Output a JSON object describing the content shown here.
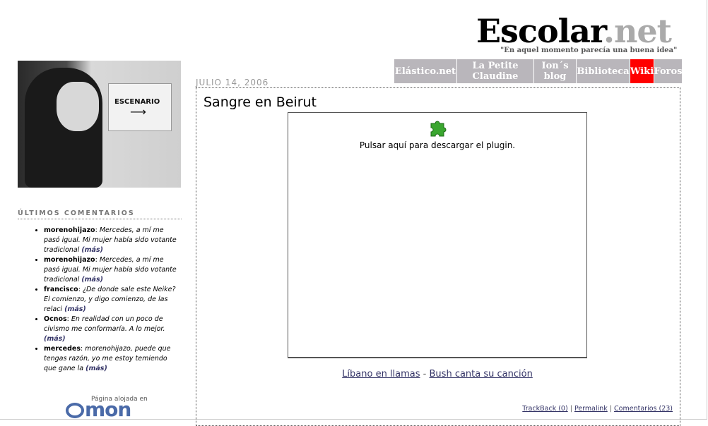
{
  "header": {
    "title_main": "Escolar",
    "title_tld": ".net",
    "tagline": "\"En aquel momento parecía una buena idea\""
  },
  "nav": {
    "items": [
      {
        "label": "Elástico.net"
      },
      {
        "label": "La Petite Claudine"
      },
      {
        "label": "Ion´s blog"
      },
      {
        "label": "Biblioteca"
      },
      {
        "label": "Wiki"
      },
      {
        "label": "Foros"
      }
    ]
  },
  "sidebar": {
    "photo_sign": "ESCENARIO",
    "comments_title": "ÚLTIMOS COMENTARIOS",
    "comments": [
      {
        "author": "morenohijazo",
        "text": "Mercedes, a mí me pasó igual. Mi mujer había sido votante tradicional",
        "more": "(más)"
      },
      {
        "author": "morenohijazo",
        "text": "Mercedes, a mí me pasó igual. Mi mujer había sido votante tradicional",
        "more": "(más)"
      },
      {
        "author": "francisco",
        "text": "¿De donde sale este Neike? El comienzo, y digo comienzo, de las relaci",
        "more": "(más)"
      },
      {
        "author": "Ocnos",
        "text": "En realidad con un poco de civismo me conformaría. A lo mejor.",
        "more": "(más)"
      },
      {
        "author": "mercedes",
        "text": "morenohijazo, puede que tengas razón, yo me estoy temiendo que gane la",
        "more": "(más)"
      }
    ],
    "hosting_label": "Página alojada en",
    "hosting_logo": "mon"
  },
  "post": {
    "date": "JULIO 14, 2006",
    "title": "Sangre en Beirut",
    "plugin_text": "Pulsar aquí para descargar el plugin.",
    "related": {
      "prev": "Líbano en llamas",
      "separator": " - ",
      "next": "Bush canta su canción"
    },
    "footer": {
      "trackback": "TrackBack (0)",
      "sep": " | ",
      "permalink": "Permalink",
      "comments": "Comentarios (23)"
    }
  },
  "colors": {
    "nav_bg": "#b9b6bb",
    "nav_active": "#ff0000",
    "link": "#333366",
    "logo": "#4a6aa8"
  }
}
